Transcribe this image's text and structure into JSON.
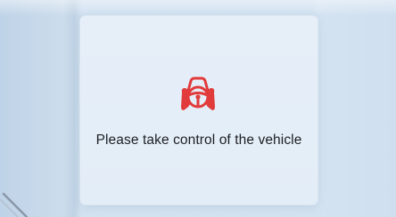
{
  "alert": {
    "icon": "hands-on-steering-wheel-icon",
    "icon_color": "#e23b3b",
    "message": "Please take control of the vehicle"
  },
  "colors": {
    "card_background": "#e5eef8",
    "page_background": "#d3e2f0",
    "text": "#1d1f23"
  }
}
